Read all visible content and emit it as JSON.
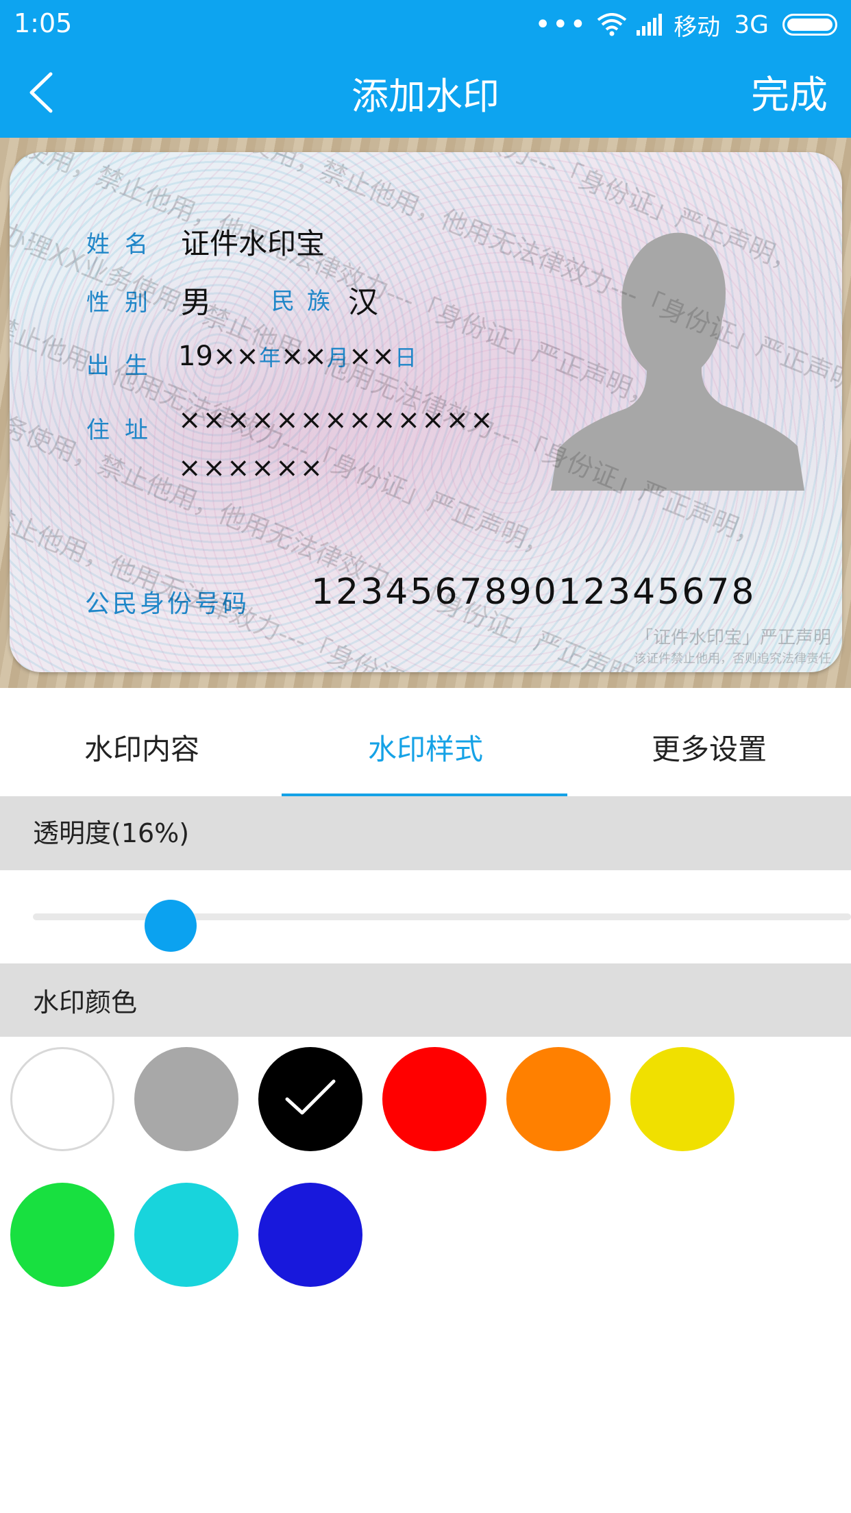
{
  "status_bar": {
    "time": "1:05",
    "dots": "•••",
    "carrier": "移动",
    "network": "3G"
  },
  "header": {
    "title": "添加水印",
    "done_label": "完成",
    "background_color": "#0da4f0"
  },
  "id_card": {
    "name_label": "姓名",
    "name_value": "证件水印宝",
    "gender_label": "性别",
    "gender_value": "男",
    "ethnicity_label": "民族",
    "ethnicity_value": "汉",
    "birth_label": "出生",
    "birth_year": "19××",
    "birth_year_unit": "年",
    "birth_month": "××",
    "birth_month_unit": "月",
    "birth_day": "××",
    "birth_day_unit": "日",
    "address_label": "住址",
    "address_line1": "×××××××××××××",
    "address_line2": "××××××",
    "id_number_label": "公民身份号码",
    "id_number_value": "12345678901234567​8",
    "watermark_text": "该证件仅供办理XX业务使用，禁止他用，他用无法律效力---「身份证」严正声明，",
    "seal_title": "「证件水印宝」严正声明",
    "seal_subtitle": "该证件禁止他用，否则追究法律责任"
  },
  "tabs": [
    {
      "label": "水印内容",
      "active": false
    },
    {
      "label": "水印样式",
      "active": true
    },
    {
      "label": "更多设置",
      "active": false
    }
  ],
  "opacity": {
    "label": "透明度(16%)",
    "value_percent": 16
  },
  "color_section": {
    "label": "水印颜色",
    "selected": "black",
    "colors": [
      {
        "name": "white",
        "hex": "#ffffff"
      },
      {
        "name": "gray",
        "hex": "#a8a8a8"
      },
      {
        "name": "black",
        "hex": "#000000"
      },
      {
        "name": "red",
        "hex": "#ff0000"
      },
      {
        "name": "orange",
        "hex": "#ff8000"
      },
      {
        "name": "yellow",
        "hex": "#f0e000"
      },
      {
        "name": "green",
        "hex": "#18e040"
      },
      {
        "name": "cyan",
        "hex": "#18d4dc"
      },
      {
        "name": "blue",
        "hex": "#1818dc"
      }
    ]
  }
}
